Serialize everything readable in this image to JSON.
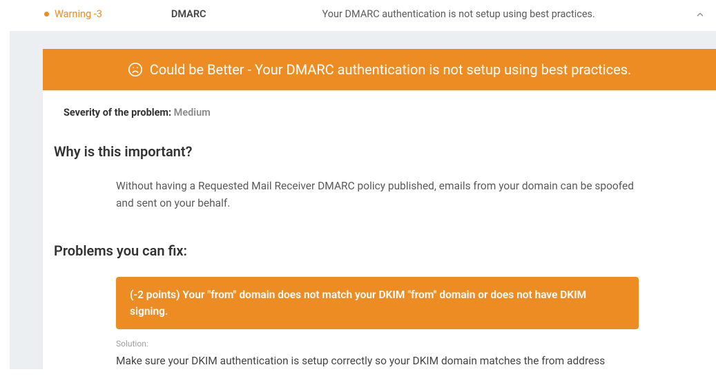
{
  "header": {
    "status": "Warning -3",
    "category": "DMARC",
    "summary": "Your DMARC authentication is not setup using best practices."
  },
  "banner": {
    "text": "Could be Better - Your DMARC authentication is not setup using best practices."
  },
  "severity": {
    "label": "Severity of the problem: ",
    "value": "Medium"
  },
  "why": {
    "heading": "Why is this important?",
    "body": "Without having a Requested Mail Receiver DMARC policy published, emails from your domain can be spoofed and sent on your behalf."
  },
  "problems": {
    "heading": "Problems you can fix:",
    "item1": "(-2 points) Your \"from\" domain does not match your DKIM \"from\" domain or does not have DKIM signing.",
    "solution_label": "Solution:",
    "solution_body": "Make sure your DKIM authentication is setup correctly so your DKIM domain matches the from address"
  }
}
